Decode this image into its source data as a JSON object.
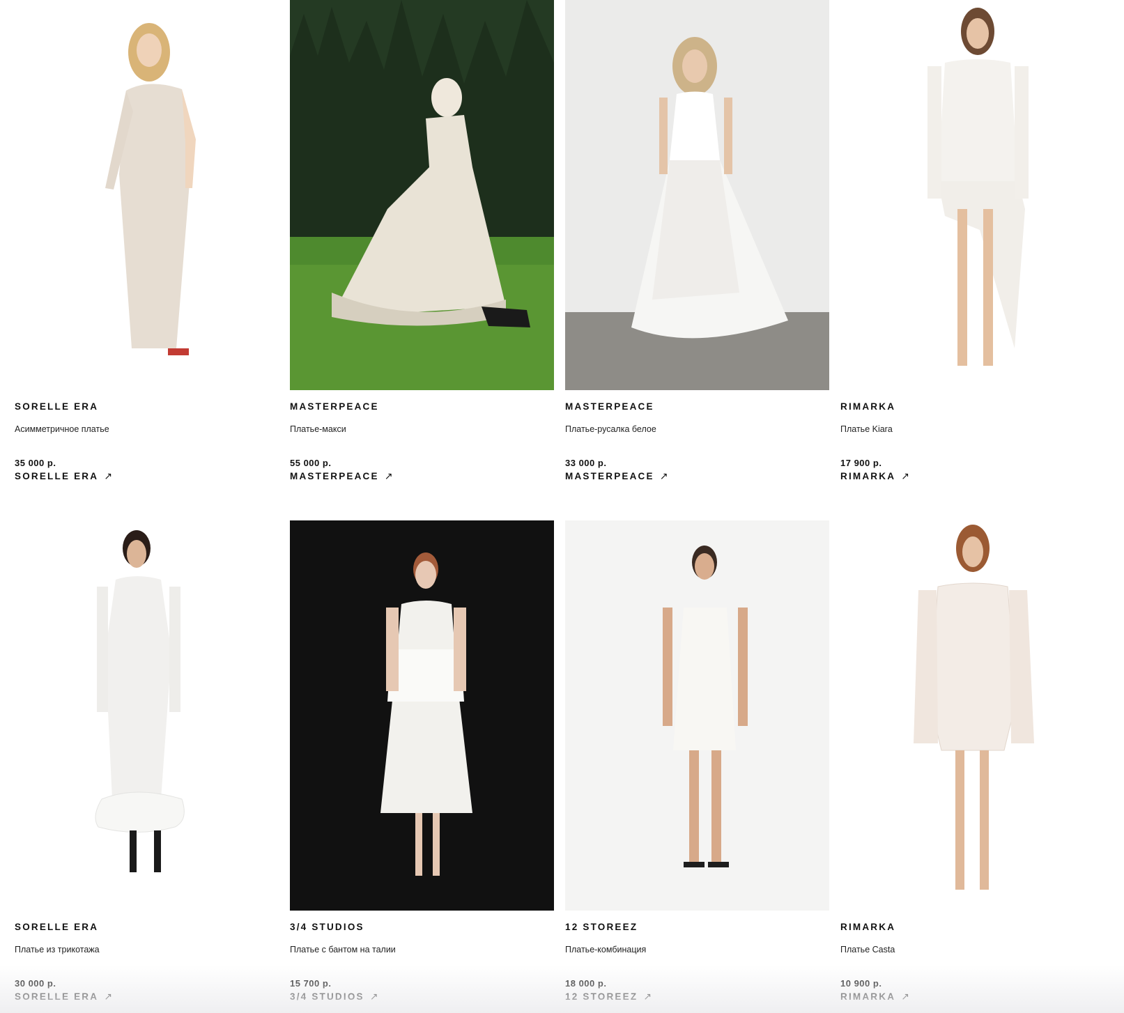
{
  "products": [
    {
      "brand": "SORELLE ERA",
      "name": "Асимметричное платье",
      "price": "35 000 р.",
      "shop": "SORELLE ERA",
      "arrow": "↗",
      "photo": "beige-asymmetric-maxi-dress-studio"
    },
    {
      "brand": "MASTERPEACE",
      "name": "Платье-макси",
      "price": "55 000 р.",
      "shop": "MASTERPEACE",
      "arrow": "↗",
      "photo": "lace-maxi-dress-garden"
    },
    {
      "brand": "MASTERPEACE",
      "name": "Платье-русалка белое",
      "price": "33 000 р.",
      "shop": "MASTERPEACE",
      "arrow": "↗",
      "photo": "white-chiffon-dress-concrete"
    },
    {
      "brand": "RIMARKA",
      "name": "Платье Kiara",
      "price": "17 900 р.",
      "shop": "RIMARKA",
      "arrow": "↗",
      "photo": "white-ruched-mini-dress-studio"
    },
    {
      "brand": "SORELLE ERA",
      "name": "Платье из трикотажа",
      "price": "30 000 р.",
      "shop": "SORELLE ERA",
      "arrow": "↗",
      "photo": "sheer-knit-midi-dress-studio"
    },
    {
      "brand": "3/4 STUDIOS",
      "name": "Платье с бантом на талии",
      "price": "15 700 р.",
      "shop": "3/4 STUDIOS",
      "arrow": "↗",
      "photo": "white-bow-dress-dark-backdrop"
    },
    {
      "brand": "12 STOREEZ",
      "name": "Платье-комбинация",
      "price": "18 000 р.",
      "shop": "12 STOREEZ",
      "arrow": "↗",
      "photo": "white-slip-dress-studio"
    },
    {
      "brand": "RIMARKA",
      "name": "Платье Casta",
      "price": "10 900 р.",
      "shop": "RIMARKA",
      "arrow": "↗",
      "photo": "lace-mini-dress-studio"
    }
  ],
  "colors": {
    "text": "#111111",
    "background": "#ffffff"
  }
}
